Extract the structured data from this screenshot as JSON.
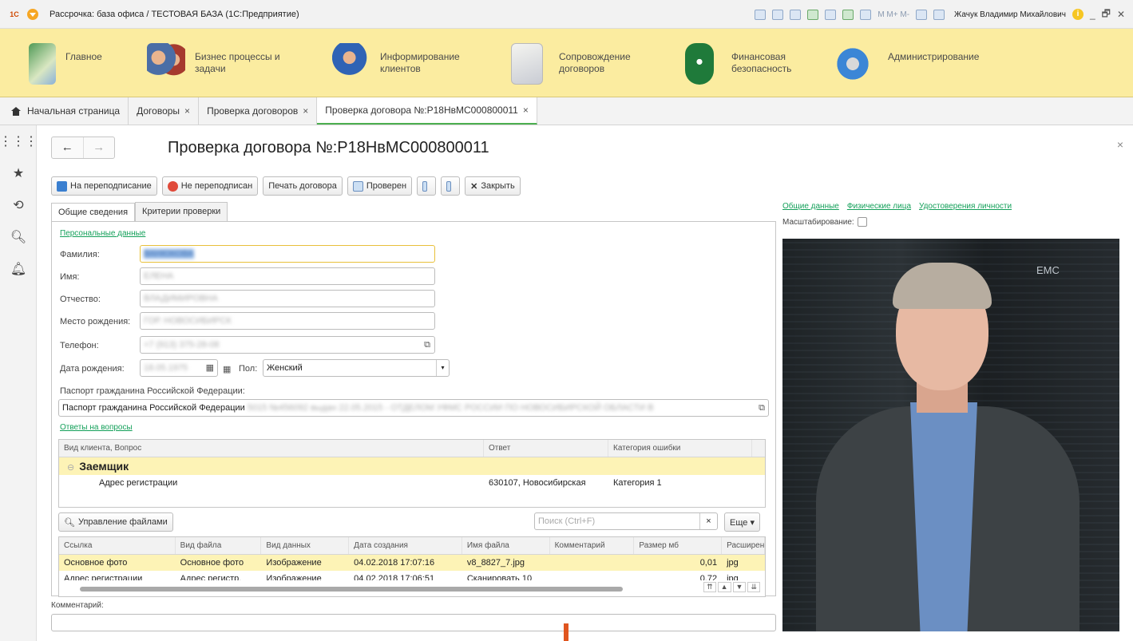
{
  "window": {
    "logo": "1С",
    "title": "Рассрочка: база офиса / ТЕСТОВАЯ БАЗА  (1С:Предприятие)",
    "toolbar_text": "M  M+  M-",
    "user": "Жачук Владимир Михайлович",
    "info": "i",
    "minimize": "_",
    "restore": "🗗",
    "close": "✕"
  },
  "sections": [
    {
      "label": "Главное"
    },
    {
      "label": "Бизнес процессы и задачи"
    },
    {
      "label": "Информирование клиентов"
    },
    {
      "label": "Сопровождение договоров"
    },
    {
      "label": "Финансовая безопасность"
    },
    {
      "label": "Администрирование"
    }
  ],
  "tabs": [
    {
      "label": "Начальная страница"
    },
    {
      "label": "Договоры",
      "close": "×"
    },
    {
      "label": "Проверка договоров",
      "close": "×"
    },
    {
      "label": "Проверка договора №:Р18НвМС000800011",
      "close": "×"
    }
  ],
  "left_panel": {
    "apps": "⋮⋮⋮",
    "favorites": "★",
    "history": "⟲",
    "search": "🔍︎",
    "notifications": "🔔︎"
  },
  "form": {
    "back": "←",
    "forward": "→",
    "title": "Проверка договора №:Р18НвМС000800011",
    "close": "×",
    "buttons": {
      "resign": "На переподписание",
      "not_resigned": "Не переподписан",
      "print": "Печать договора",
      "checked": "Проверен",
      "close": "Закрыть"
    },
    "tabs": {
      "general": "Общие сведения",
      "criteria": "Критерии проверки"
    },
    "personal_link": "Персональные данные",
    "labels": {
      "surname": "Фамилия:",
      "name": "Имя:",
      "patronymic": "Отчество:",
      "birthplace": "Место рождения:",
      "phone": "Телефон:",
      "birthdate": "Дата рождения:",
      "gender": "Пол:",
      "passport": "Паспорт гражданина Российской Федерации:"
    },
    "values": {
      "surname": "ВАНЮКОВА",
      "name": "ЕЛЕНА",
      "patronymic": "ВЛАДИМИРОВНА",
      "birthplace": "ГОР. НОВОСИБИРСК",
      "phone": "+7 (913) 375-28-08",
      "birthdate": "18.05.1975",
      "gender": "Женский",
      "passport_visible": "Паспорт гражданина Российской Федерации",
      "passport_blur": "5015 №456092 выдан 22.05.2015 - ОТДЕЛОМ УФМС РОССИИ ПО НОВОСИБИРСКОЙ ОБЛАСТИ В"
    },
    "answers_link": "Ответы на вопросы",
    "questions": {
      "headers": [
        "Вид клиента, Вопрос",
        "Ответ",
        "Категория ошибки"
      ],
      "group": "Заемщик",
      "rows": [
        [
          "Адрес регистрации",
          "630107, Новосибирская",
          "Категория 1"
        ]
      ]
    },
    "files_button": "Управление файлами",
    "search_placeholder": "Поиск (Ctrl+F)",
    "more": "Еще ▾",
    "files": {
      "headers": [
        "Ссылка",
        "Вид файла",
        "Вид данных",
        "Дата создания",
        "Имя файла",
        "Комментарий",
        "Размер мб",
        "Расширен"
      ],
      "rows": [
        [
          "Основное фото",
          "Основное фото",
          "Изображение",
          "04.02.2018 17:07:16",
          "v8_8827_7.jpg",
          "",
          "0,01",
          "jpg"
        ],
        [
          "Адрес регистрации",
          "Адрес регистр.",
          "Изображение",
          "04.02.2018 17:06:51",
          "Сканировать 10",
          "",
          "0,72",
          "jpg"
        ]
      ]
    },
    "comment_label": "Комментарий:"
  },
  "photo_panel": {
    "links": [
      "Общие данные",
      "Физические лица",
      "Удостоверения личности"
    ],
    "scale_label": "Масштабирование:",
    "brand": "EMC"
  }
}
